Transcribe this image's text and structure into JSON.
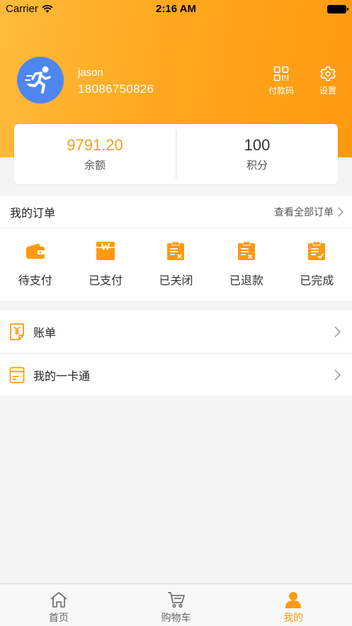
{
  "status_bar": {
    "carrier": "Carrier",
    "time": "2:16 AM"
  },
  "profile": {
    "username": "jason",
    "phone": "18086750826"
  },
  "header_actions": [
    {
      "label": "付款码",
      "icon": "qrcode-icon"
    },
    {
      "label": "设置",
      "icon": "gear-icon"
    }
  ],
  "balance_card": {
    "balance_value": "9791.20",
    "balance_label": "余额",
    "points_value": "100",
    "points_label": "积分"
  },
  "orders": {
    "title": "我的订单",
    "view_all": "查看全部订单",
    "items": [
      {
        "label": "待支付",
        "icon": "wallet-icon"
      },
      {
        "label": "已支付",
        "icon": "package-icon"
      },
      {
        "label": "已关闭",
        "icon": "clipboard-close-icon"
      },
      {
        "label": "已退款",
        "icon": "clipboard-refund-icon"
      },
      {
        "label": "已完成",
        "icon": "clipboard-check-icon"
      }
    ]
  },
  "menu": [
    {
      "label": "账单",
      "icon": "bill-icon"
    },
    {
      "label": "我的一卡通",
      "icon": "card-icon"
    }
  ],
  "tabbar": [
    {
      "label": "首页",
      "icon": "home-icon"
    },
    {
      "label": "购物车",
      "icon": "cart-icon"
    },
    {
      "label": "我的",
      "icon": "user-icon"
    }
  ],
  "colors": {
    "accent": "#ff9a10",
    "header_gradient_start": "#ffbb3c",
    "avatar_bg": "#4e86f2",
    "balance_text": "#f0a020"
  }
}
